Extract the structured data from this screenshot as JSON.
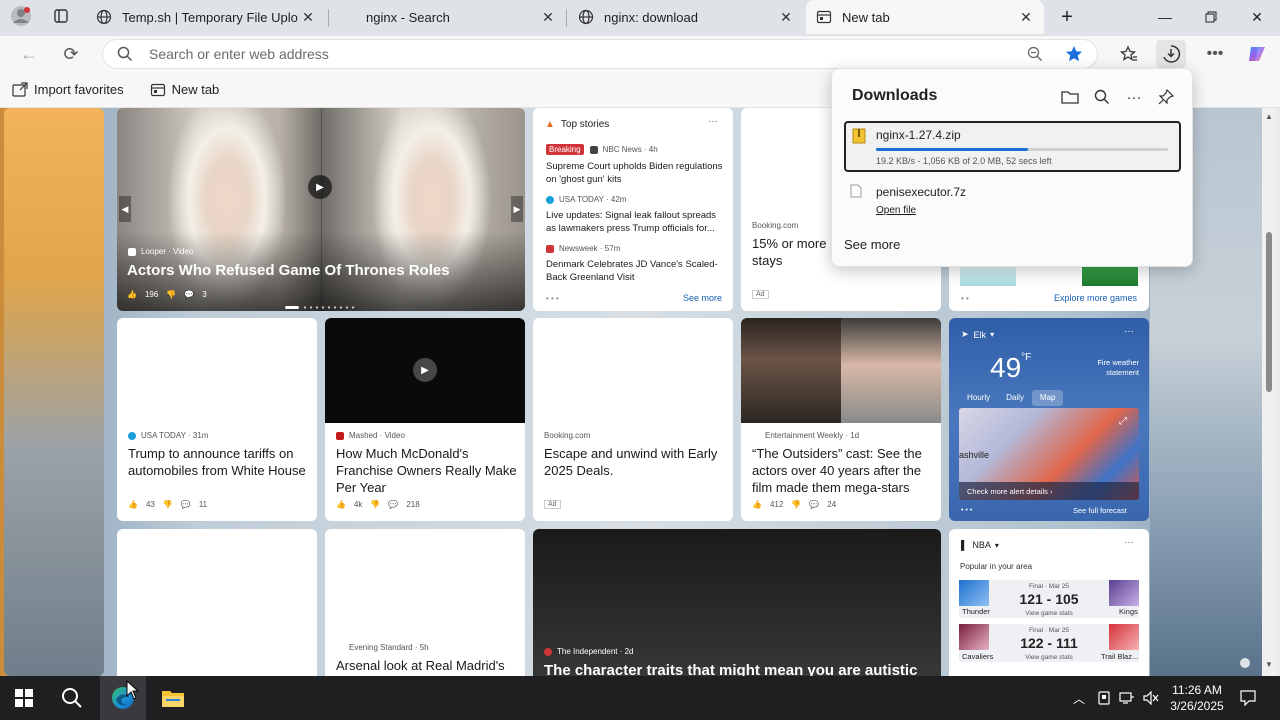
{
  "tabs": [
    {
      "title": "Temp.sh | Temporary File Upload",
      "active": false
    },
    {
      "title": "nginx - Search",
      "active": false
    },
    {
      "title": "nginx: download",
      "active": false
    },
    {
      "title": "New tab",
      "active": true
    }
  ],
  "toolbar": {
    "address_placeholder": "Search or enter web address"
  },
  "favorites": [
    {
      "label": "Import favorites"
    },
    {
      "label": "New tab"
    }
  ],
  "hero": {
    "source": "Looper · Video",
    "title": "Actors Who Refused Game Of Thrones Roles",
    "likes": "196",
    "comments": "3"
  },
  "top_stories": {
    "header": "Top stories",
    "items": [
      {
        "badge": "Breaking",
        "source": "NBC News · 4h",
        "title": "Supreme Court upholds Biden regulations on 'ghost gun' kits"
      },
      {
        "source": "USA TODAY · 42m",
        "title": "Live updates: Signal leak fallout spreads as lawmakers press Trump officials for..."
      },
      {
        "source": "Newsweek · 57m",
        "title": "Denmark Celebrates JD Vance's Scaled-Back Greenland Visit"
      }
    ],
    "see_more": "See more"
  },
  "booking_top": {
    "source": "Booking.com",
    "title": "15% or more stays",
    "ad": "Ad"
  },
  "games": {
    "explore": "Explore more games"
  },
  "row2": [
    {
      "source": "USA TODAY · 31m",
      "title": "Trump to announce tariffs on automobiles from White House",
      "likes": "43",
      "comments": "11"
    },
    {
      "source": "Mashed · Video",
      "title": "How Much McDonald's Franchise Owners Really Make Per Year",
      "likes": "4k",
      "comments": "218"
    },
    {
      "source": "Booking.com",
      "title": "Escape and unwind with Early 2025 Deals.",
      "ad": "Ad"
    },
    {
      "source": "Entertainment Weekly · 1d",
      "title": "“The Outsiders” cast: See the actors over 40 years after the film made them mega-stars",
      "likes": "412",
      "comments": "24"
    }
  ],
  "weather": {
    "location": "Elk",
    "temp": "49",
    "unit": "°F",
    "alert": "Fire weather statement",
    "tabs": [
      "Hourly",
      "Daily",
      "Map"
    ],
    "map_label": "ashville",
    "alert_link": "Check more alert details",
    "forecast": "See full forecast"
  },
  "row3": [
    {
      "source": "Evening Standard · 5h",
      "title": "Arsenal look at Real Madrid's"
    },
    {
      "source": "The Independent · 2d",
      "title": "The character traits that might mean you are autistic"
    }
  ],
  "nba": {
    "header": "NBA",
    "subtitle": "Popular in your area",
    "games": [
      {
        "status": "Final · Mar 25",
        "score": "121 - 105",
        "home": "Thunder",
        "away": "Kings",
        "stats": "View game stats"
      },
      {
        "status": "Final · Mar 25",
        "score": "122 - 111",
        "home": "Cavaliers",
        "away": "Trail Blaz...",
        "stats": "View game stats"
      }
    ]
  },
  "downloads": {
    "title": "Downloads",
    "items": [
      {
        "name": "nginx-1.27.4.zip",
        "status": "19.2 KB/s - 1,056 KB of 2.0 MB, 52 secs left",
        "progress": 0.52
      },
      {
        "name": "penisexecutor.7z",
        "action": "Open file"
      }
    ],
    "see_more": "See more"
  },
  "taskbar": {
    "time": "11:26 AM",
    "date": "3/26/2025"
  },
  "colors": {
    "accent": "#1a6fd8",
    "breaking": "#d13438",
    "taskbar": "#1f1f22"
  }
}
